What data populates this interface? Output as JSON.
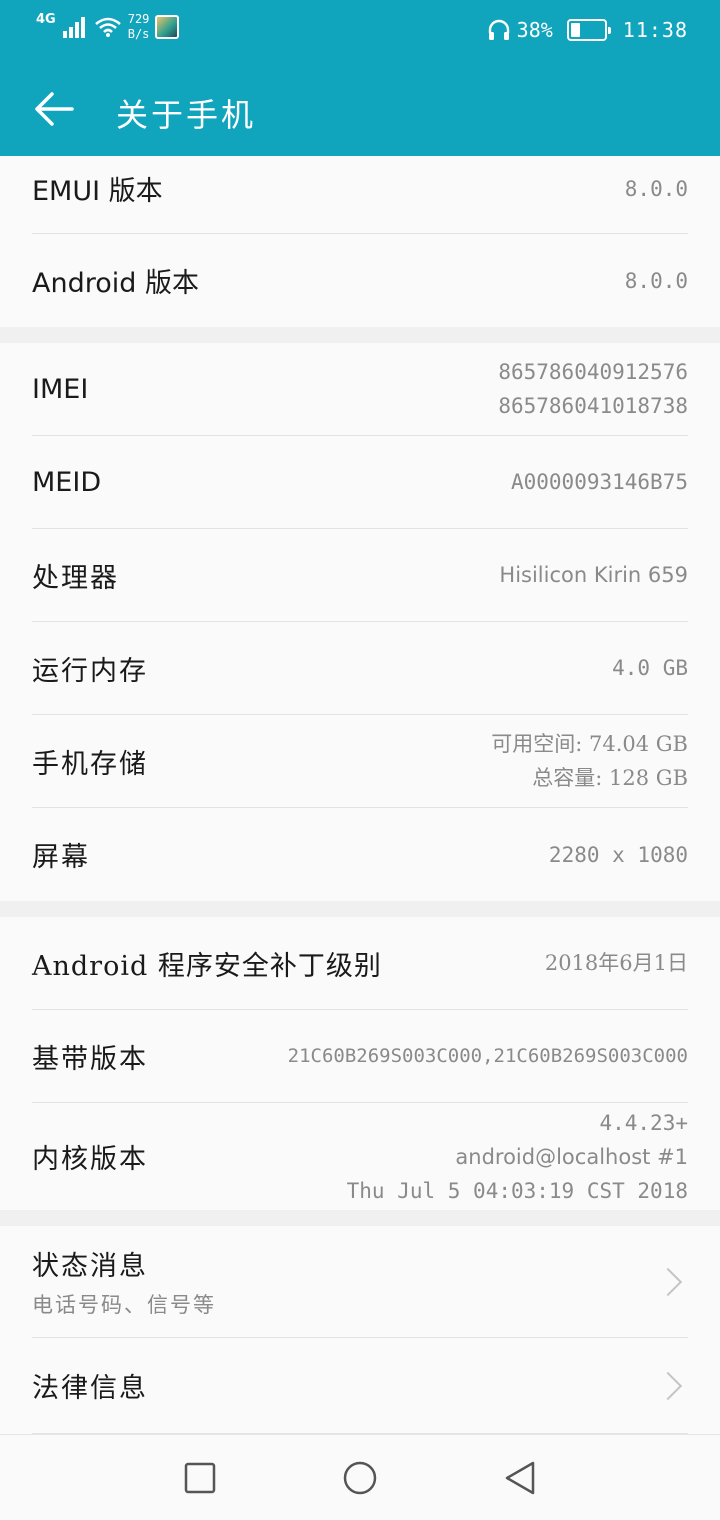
{
  "status_bar": {
    "network_type": "4G",
    "speed_value": "729",
    "speed_unit": "B/s",
    "battery_percent": "38%",
    "battery_level": 0.38,
    "time": "11:38"
  },
  "app_bar": {
    "title": "关于手机"
  },
  "group1": [
    {
      "label": "EMUI 版本",
      "value": "8.0.0"
    },
    {
      "label": "Android 版本",
      "value": "8.0.0"
    }
  ],
  "group2": {
    "imei": {
      "label": "IMEI",
      "values": [
        "865786040912576",
        "865786041018738"
      ]
    },
    "meid": {
      "label": "MEID",
      "value": "A0000093146B75"
    },
    "processor": {
      "label": "处理器",
      "value": "Hisilicon Kirin 659"
    },
    "ram": {
      "label": "运行内存",
      "value": "4.0 GB"
    },
    "storage": {
      "label": "手机存储",
      "available": "可用空间: 74.04  GB",
      "total": "总容量: 128  GB"
    },
    "screen": {
      "label": "屏幕",
      "value": "2280 x 1080"
    }
  },
  "group3": {
    "security_patch": {
      "label": "Android 程序安全补丁级别",
      "value": "2018年6月1日"
    },
    "baseband": {
      "label": "基带版本",
      "value": "21C60B269S003C000,21C60B269S003C000"
    },
    "kernel": {
      "label": "内核版本",
      "lines": [
        "4.4.23+",
        "android@localhost  #1",
        "Thu Jul 5 04:03:19 CST 2018"
      ]
    }
  },
  "group4": [
    {
      "label": "状态消息",
      "sub": "电话号码、信号等"
    },
    {
      "label": "法律信息"
    }
  ],
  "colors": {
    "accent": "#10a5bd",
    "background": "#fafafa",
    "secondary_text": "#8a8a8a"
  },
  "icons": [
    "signal-icon",
    "wifi-icon",
    "headphones-icon",
    "battery-icon",
    "back-arrow-icon",
    "chevron-right-icon",
    "recents-icon",
    "home-icon",
    "back-nav-icon"
  ]
}
